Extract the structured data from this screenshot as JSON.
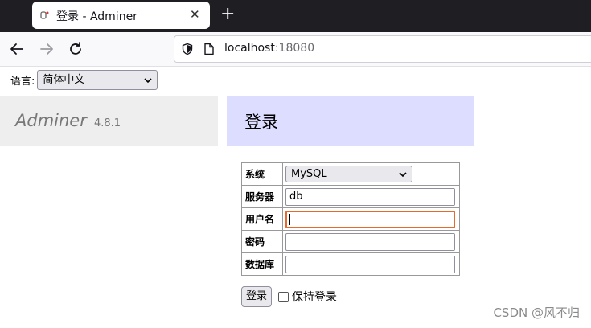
{
  "browser": {
    "tab_title": "登录 - Adminer",
    "url_host": "localhost",
    "url_port": ":18080"
  },
  "language": {
    "label": "语言:",
    "selected": "简体中文"
  },
  "brand": {
    "name": "Adminer",
    "version": "4.8.1"
  },
  "page_title": "登录",
  "login_form": {
    "system_label": "系统",
    "system_value": "MySQL",
    "server_label": "服务器",
    "server_value": "db",
    "username_label": "用户名",
    "username_value": "",
    "password_label": "密码",
    "password_value": "",
    "database_label": "数据库",
    "database_value": "",
    "submit_label": "登录",
    "remember_label": "保持登录"
  },
  "watermark": "CSDN @风不归"
}
